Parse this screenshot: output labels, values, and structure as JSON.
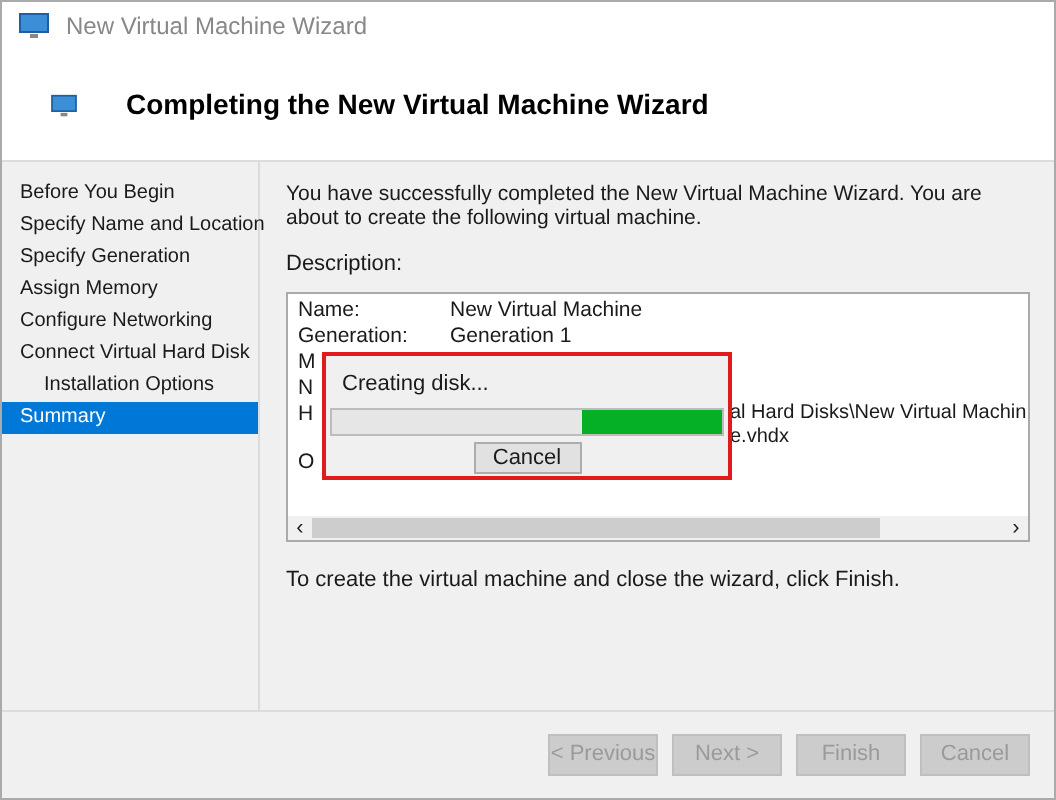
{
  "window": {
    "title": "New Virtual Machine Wizard"
  },
  "header": {
    "title": "Completing the New Virtual Machine Wizard"
  },
  "sidebar": {
    "items": [
      {
        "label": "Before You Begin",
        "selected": false
      },
      {
        "label": "Specify Name and Location",
        "selected": false
      },
      {
        "label": "Specify Generation",
        "selected": false
      },
      {
        "label": "Assign Memory",
        "selected": false
      },
      {
        "label": "Configure Networking",
        "selected": false
      },
      {
        "label": "Connect Virtual Hard Disk",
        "selected": false,
        "children": [
          {
            "label": "Installation Options",
            "selected": false
          }
        ]
      },
      {
        "label": "Summary",
        "selected": true
      }
    ]
  },
  "intro": "You have successfully completed the New Virtual Machine Wizard. You are about to create the following virtual machine.",
  "description": {
    "label": "Description:",
    "rows": [
      {
        "key": "Name:",
        "value": "New Virtual Machine"
      },
      {
        "key": "Generation:",
        "value": "Generation 1"
      },
      {
        "key": "M"
      },
      {
        "key": "N"
      },
      {
        "key": "H",
        "value": "al Hard Disks\\New Virtual Machine.vhdx"
      },
      {
        "key": "O"
      }
    ],
    "scrollbar": {
      "left": "‹",
      "right": "›"
    }
  },
  "progress_dialog": {
    "message": "Creating disk...",
    "button": "Cancel"
  },
  "outro": "To create the virtual machine and close the wizard, click Finish.",
  "buttons": [
    {
      "label": "< Previous",
      "disabled": true
    },
    {
      "label": "Next >",
      "disabled": true
    },
    {
      "label": "Finish",
      "disabled": true
    },
    {
      "label": "Cancel",
      "disabled": true
    }
  ]
}
